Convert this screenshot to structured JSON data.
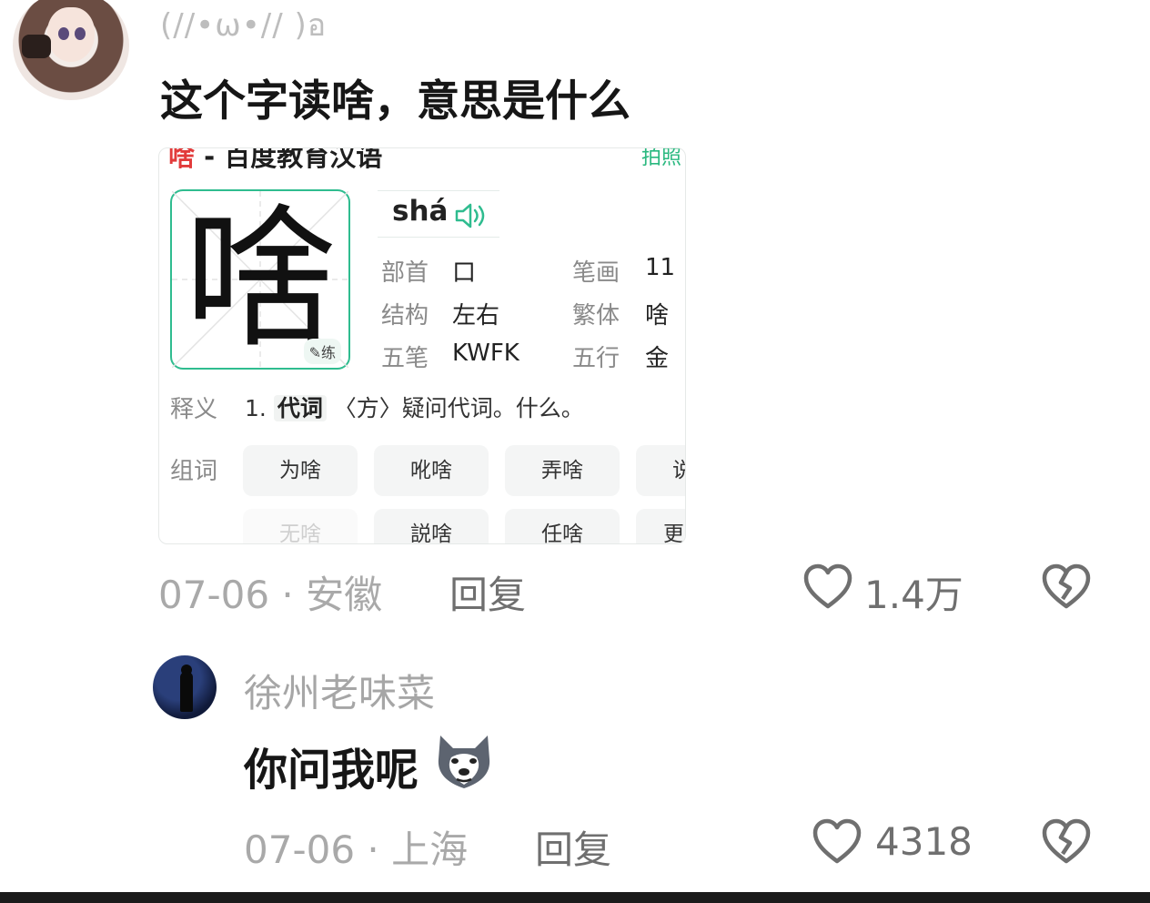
{
  "comment1": {
    "nickname": "(//•ω•// )อ",
    "text": "这个字读啥，意思是什么",
    "date": "07-06",
    "location": "安徽",
    "reply_label": "回复",
    "likes": "1.4万"
  },
  "dictionary": {
    "header_char": "啥",
    "header_title": " - 百度教育汉语",
    "header_right": "拍照",
    "character": "啥",
    "practice_label": "练",
    "pinyin": "shá",
    "props": [
      {
        "label": "部首",
        "value": "口"
      },
      {
        "label": "笔画",
        "value": "11"
      },
      {
        "label": "结构",
        "value": "左右"
      },
      {
        "label": "繁体",
        "value": "啥"
      },
      {
        "label": "五笔",
        "value": "KWFK"
      },
      {
        "label": "五行",
        "value": "金"
      }
    ],
    "definition_label": "释义",
    "definition_index": "1.",
    "definition_pos": "代词",
    "definition_text": "〈方〉疑问代词。什么。",
    "words_label": "组词",
    "words_row1": [
      "为啥",
      "吪啥",
      "弄啥",
      "说"
    ],
    "words_row2": [
      "无啥",
      "説啥",
      "任啥",
      "更"
    ]
  },
  "comment2": {
    "nickname": "徐州老味菜",
    "text": "你问我呢",
    "emoji": "husky-emoji",
    "date": "07-06",
    "location": "上海",
    "reply_label": "回复",
    "likes": "4318"
  },
  "separator": "·",
  "colors": {
    "accent_green": "#2fbc8f",
    "red": "#e23b3b",
    "meta_gray": "#a9a9a9",
    "text_dark": "#161616"
  }
}
